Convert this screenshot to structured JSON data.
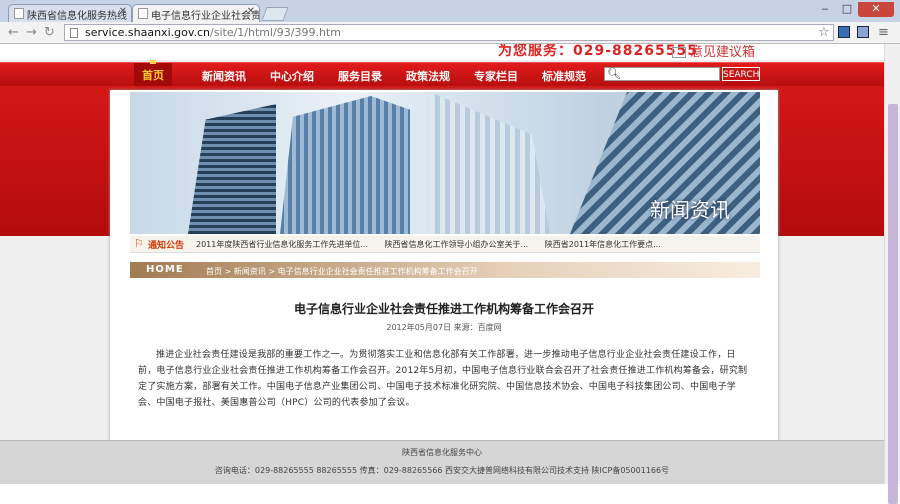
{
  "browser": {
    "tabs": [
      {
        "label": "陕西省信息化服务热线"
      },
      {
        "label": "电子信息行业企业社会责"
      }
    ],
    "url_host": "service.shaanxi.gov.cn",
    "url_path": "/site/1/html/93/399.htm",
    "window_buttons": {
      "minimize": "‒",
      "maximize": "□",
      "close": "✕"
    }
  },
  "header": {
    "hotline": "为您服务：029-88265555",
    "suggest": "意见建议箱"
  },
  "nav": {
    "items": [
      "首页",
      "新闻资讯",
      "中心介绍",
      "服务目录",
      "政策法规",
      "专家栏目",
      "标准规范"
    ],
    "search_placeholder": "",
    "search_button": "SEARCH"
  },
  "banner": {
    "title": "新闻资讯"
  },
  "notice": {
    "label": "通知公告",
    "items": [
      "2011年度陕西省行业信息化服务工作先进单位...",
      "陕西省信息化工作领导小组办公室关于...",
      "陕西省2011年信息化工作要点..."
    ]
  },
  "breadcrumb": {
    "home": "HOME",
    "path": "首页 > 新闻资讯 > 电子信息行业企业社会责任推进工作机构筹备工作会召开"
  },
  "article": {
    "title": "电子信息行业企业社会责任推进工作机构筹备工作会召开",
    "meta": "2012年05月07日 来源：百度网",
    "body": "推进企业社会责任建设是我部的重要工作之一。为贯彻落实工业和信息化部有关工作部署，进一步推动电子信息行业企业社会责任建设工作，日前，电子信息行业企业社会责任推进工作机构筹备工作会召开。2012年5月初，中国电子信息行业联合会召开了社会责任推进工作机构筹备会，研究制定了实施方案，部署有关工作。中国电子信息产业集团公司、中国电子技术标准化研究院、中国信息技术协会、中国电子科技集团公司、中国电子学会、中国电子报社、美国惠普公司（HPC）公司的代表参加了会议。"
  },
  "footer": {
    "line1": "陕西省信息化服务中心",
    "line2": "咨询电话：029-88265555 88265555  传真：029-88265566  西安交大捷普网络科技有限公司技术支持  陕ICP备05001166号"
  }
}
